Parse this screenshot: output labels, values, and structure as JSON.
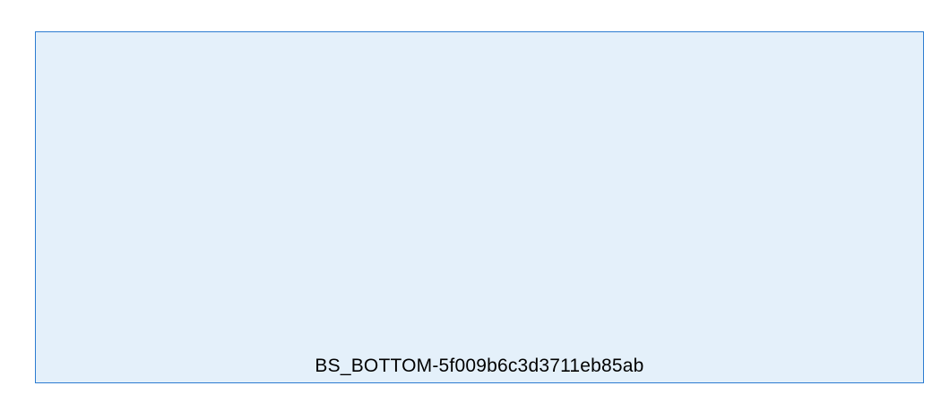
{
  "button": {
    "label": "BS_BOTTOM-5f009b6c3d3711eb85ab"
  },
  "colors": {
    "background": "#ffffff",
    "button_fill": "#e4f0fa",
    "button_border": "#2c7cd1",
    "text": "#000000"
  }
}
